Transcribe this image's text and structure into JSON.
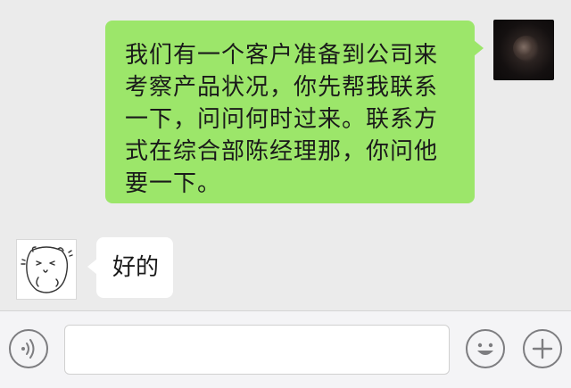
{
  "messages": [
    {
      "sender": "self",
      "text": "我们有一个客户准备到公司来考察产品状况，你先帮我联系一下，问问何时过来。联系方式在综合部陈经理那，你问他要一下。"
    },
    {
      "sender": "other",
      "text": "好的"
    }
  ],
  "input_bar": {
    "draft": "",
    "left_icon": "voice-icon",
    "right_icons": [
      "emoji-icon",
      "plus-icon"
    ]
  },
  "colors": {
    "background": "#ebebeb",
    "self_bubble": "#9ce66a",
    "other_bubble": "#ffffff"
  }
}
